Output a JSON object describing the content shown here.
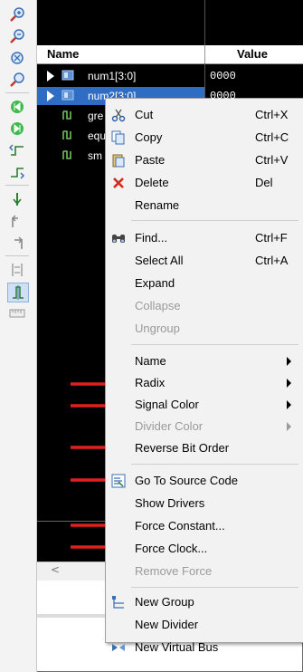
{
  "header": {
    "name": "Name",
    "value": "Value"
  },
  "signals": [
    {
      "label": "num1[3:0]",
      "value": "0000",
      "expandable": true
    },
    {
      "label": "num2[3:0]",
      "value": "0000",
      "expandable": true,
      "selected": true
    },
    {
      "label": "gre",
      "value": "",
      "expandable": false
    },
    {
      "label": "equ",
      "value": "",
      "expandable": false
    },
    {
      "label": "sm",
      "value": "",
      "expandable": false
    }
  ],
  "scroll": {
    "left_arrow": "<"
  },
  "menu": {
    "items": [
      {
        "label": "Cut",
        "shortcut": "Ctrl+X",
        "icon": "scissors-icon"
      },
      {
        "label": "Copy",
        "shortcut": "Ctrl+C",
        "icon": "copy-icon"
      },
      {
        "label": "Paste",
        "shortcut": "Ctrl+V",
        "icon": "paste-icon"
      },
      {
        "label": "Delete",
        "shortcut": "Del",
        "icon": "delete-x-icon"
      },
      {
        "label": "Rename",
        "shortcut": ""
      },
      {
        "label": "Find...",
        "shortcut": "Ctrl+F",
        "icon": "binoculars-icon"
      },
      {
        "label": "Select All",
        "shortcut": "Ctrl+A"
      },
      {
        "label": "Expand",
        "shortcut": ""
      },
      {
        "label": "Collapse",
        "shortcut": "",
        "disabled": true
      },
      {
        "label": "Ungroup",
        "shortcut": "",
        "disabled": true
      },
      {
        "label": "Name",
        "submenu": true
      },
      {
        "label": "Radix",
        "submenu": true
      },
      {
        "label": "Signal Color",
        "submenu": true
      },
      {
        "label": "Divider Color",
        "submenu": true,
        "disabled": true
      },
      {
        "label": "Reverse Bit Order"
      },
      {
        "label": "Go To Source Code",
        "icon": "source-code-icon"
      },
      {
        "label": "Show Drivers"
      },
      {
        "label": "Force Constant..."
      },
      {
        "label": "Force Clock..."
      },
      {
        "label": "Remove Force",
        "disabled": true
      },
      {
        "label": "New Group",
        "icon": "group-icon"
      },
      {
        "label": "New Divider"
      },
      {
        "label": "New Virtual Bus",
        "icon": "virtual-bus-icon"
      }
    ]
  },
  "colors": {
    "annotation_arrow": "#e0201c",
    "selection": "#2f6cc4",
    "menu_bg": "#f2f2f2"
  }
}
